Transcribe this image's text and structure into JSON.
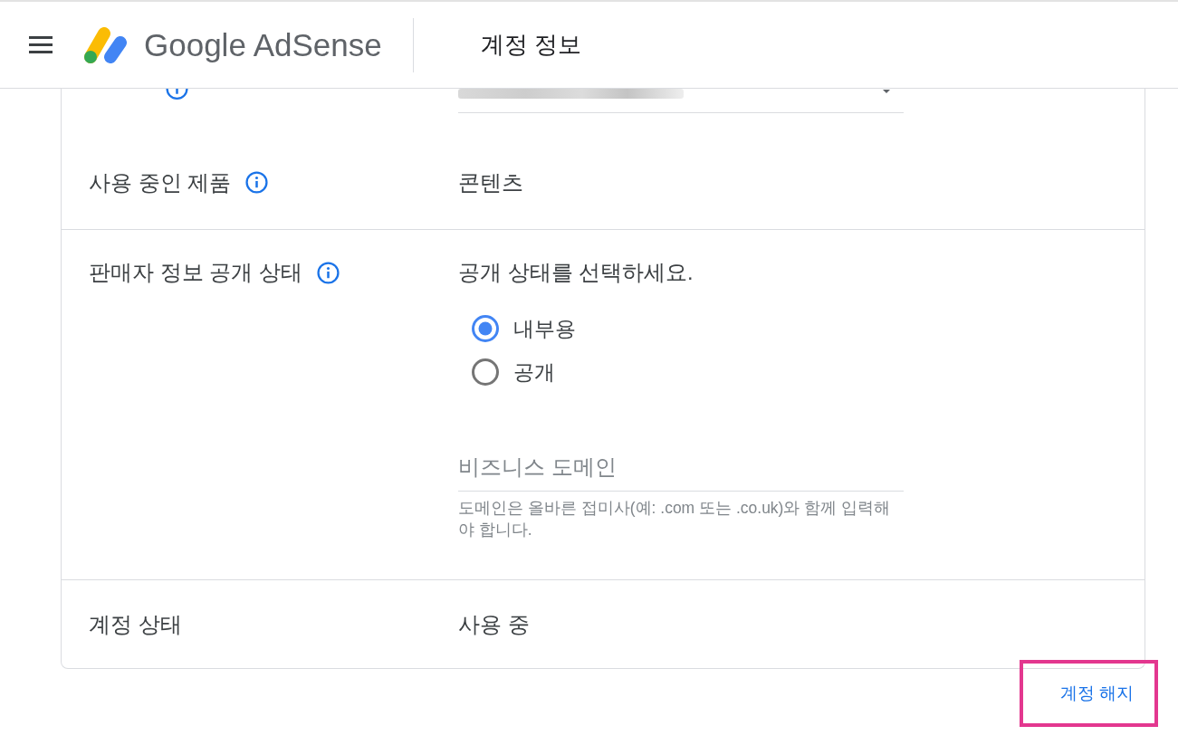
{
  "header": {
    "brand": "Google AdSense",
    "title": "계정 정보"
  },
  "sections": [
    {
      "rows": [
        {
          "kind": "dropdown",
          "info_icon": true,
          "redacted": true
        },
        {
          "kind": "text",
          "label": "사용 중인 제품",
          "info_icon": true,
          "value": "콘텐츠"
        }
      ]
    },
    {
      "rows": [
        {
          "kind": "visibility",
          "label": "판매자 정보 공개 상태",
          "info_icon": true,
          "prompt": "공개 상태를 선택하세요.",
          "options": [
            {
              "label": "내부용",
              "selected": true
            },
            {
              "label": "공개",
              "selected": false
            }
          ],
          "domain_field": {
            "placeholder": "비즈니스 도메인"
          },
          "helper": "도메인은 올바른 접미사(예: .com 또는 .co.uk)와 함께 입력해야 합니다."
        }
      ]
    },
    {
      "rows": [
        {
          "kind": "text",
          "label": "계정 상태",
          "value": "사용 중"
        }
      ]
    }
  ],
  "close_account": {
    "label": "계정 해지",
    "highlighted": true
  }
}
